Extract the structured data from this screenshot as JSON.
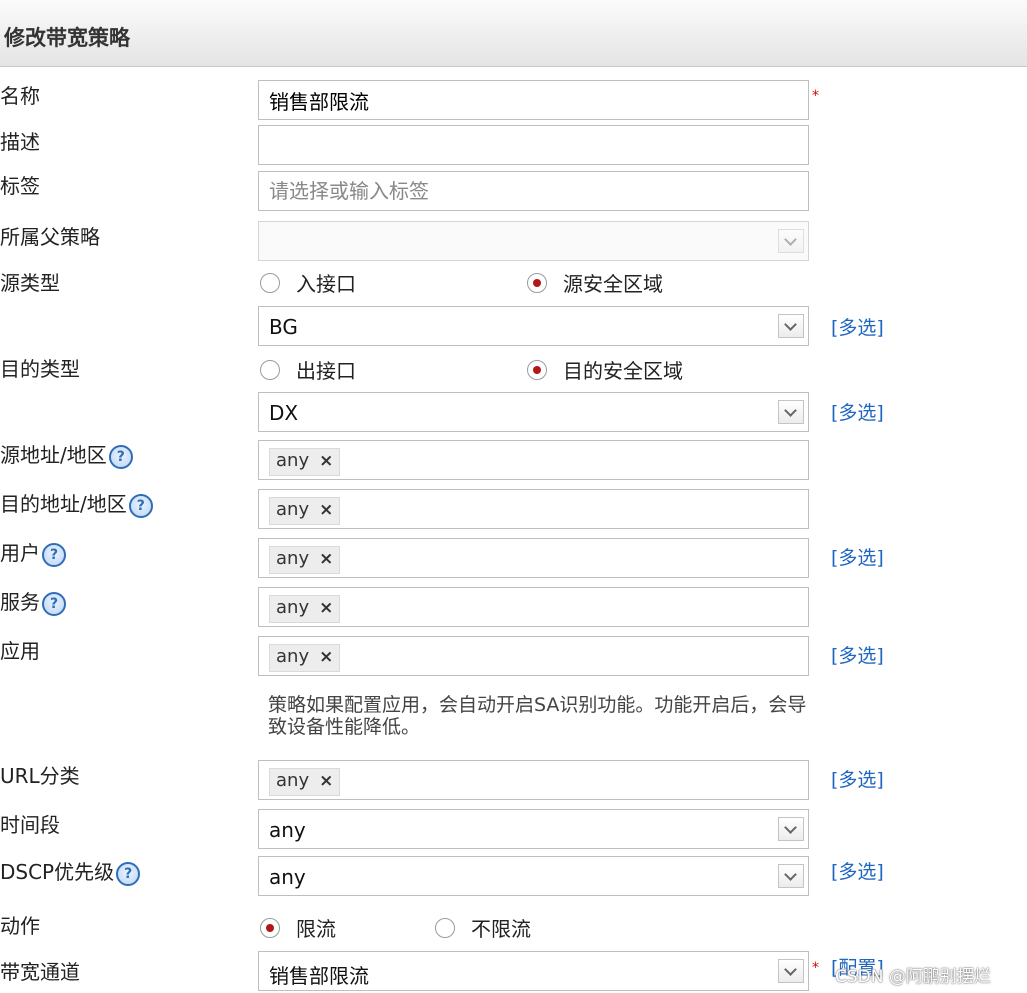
{
  "header": {
    "title": "修改带宽策略"
  },
  "help_glyph": "?",
  "remove_glyph": "×",
  "required_mark": "*",
  "name": {
    "label": "名称",
    "value": "销售部限流"
  },
  "description": {
    "label": "描述",
    "value": ""
  },
  "tags": {
    "label": "标签",
    "placeholder": "请选择或输入标签"
  },
  "parent_policy": {
    "label": "所属父策略",
    "value": ""
  },
  "source_type": {
    "label": "源类型",
    "option_interface": "入接口",
    "option_zone": "源安全区域",
    "selected": "源安全区域",
    "zone_value": "BG",
    "multi_select": "[多选]"
  },
  "dest_type": {
    "label": "目的类型",
    "option_interface": "出接口",
    "option_zone": "目的安全区域",
    "selected": "目的安全区域",
    "zone_value": "DX",
    "multi_select": "[多选]"
  },
  "source_address": {
    "label": "源地址/地区",
    "tag": "any"
  },
  "dest_address": {
    "label": "目的地址/地区",
    "tag": "any"
  },
  "user": {
    "label": "用户",
    "tag": "any",
    "multi_select": "[多选]"
  },
  "service": {
    "label": "服务",
    "tag": "any"
  },
  "application": {
    "label": "应用",
    "tag": "any",
    "multi_select": "[多选]",
    "hint": "策略如果配置应用，会自动开启SA识别功能。功能开启后，会导致设备性能降低。"
  },
  "url_category": {
    "label": "URL分类",
    "tag": "any",
    "multi_select": "[多选]"
  },
  "time_range": {
    "label": "时间段",
    "value": "any"
  },
  "dscp": {
    "label": "DSCP优先级",
    "value": "any",
    "multi_select": "[多选]"
  },
  "action": {
    "label": "动作",
    "option_limit": "限流",
    "option_nolimit": "不限流",
    "selected": "限流"
  },
  "bandwidth_channel": {
    "label": "带宽通道",
    "value": "销售部限流",
    "config_link": "[配置]"
  },
  "watermark": "CSDN @阿鹏别摆烂",
  "colors": {
    "link": "#1f66c2",
    "radio_selected": "#b41717",
    "required": "#dd0000"
  }
}
